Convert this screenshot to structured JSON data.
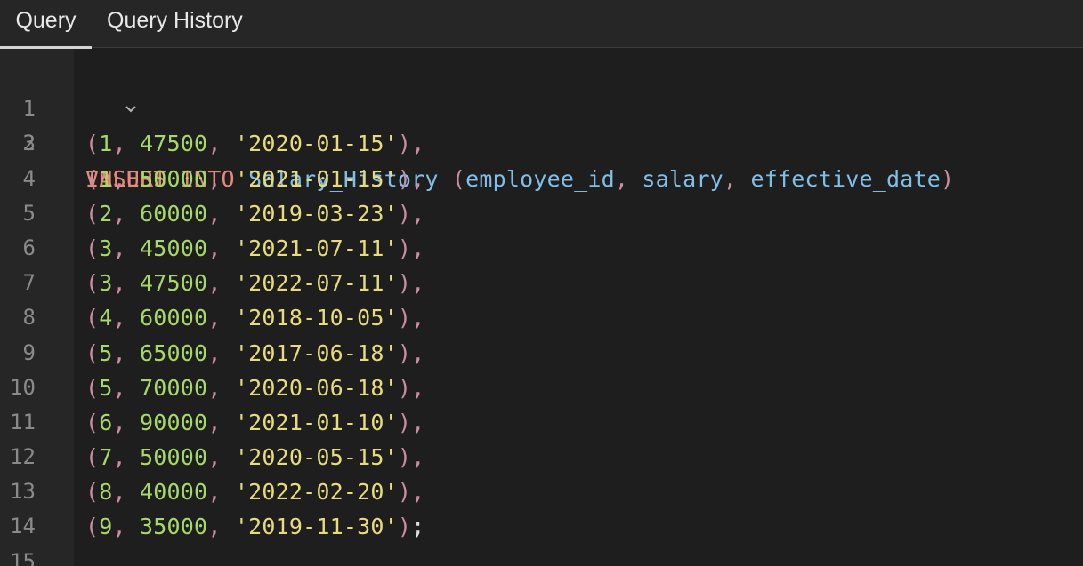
{
  "tabs": [
    {
      "label": "Query",
      "active": true
    },
    {
      "label": "Query History",
      "active": false
    }
  ],
  "editor": {
    "line_numbers": [
      "1",
      "2",
      "3",
      "4",
      "5",
      "6",
      "7",
      "8",
      "9",
      "10",
      "11",
      "12",
      "13",
      "14",
      "15"
    ],
    "fold_icon": "chevron-down-icon",
    "statement": {
      "insert_kw": "INSERT",
      "into_kw": "INTO",
      "table": "Salary_History",
      "columns": [
        "employee_id",
        "salary",
        "effective_date"
      ],
      "values_kw": "VALUES",
      "rows": [
        {
          "id": "1",
          "salary": "47500",
          "date": "'2020-01-15'",
          "end": ","
        },
        {
          "id": "1",
          "salary": "50000",
          "date": "'2021-01-15'",
          "end": ","
        },
        {
          "id": "2",
          "salary": "60000",
          "date": "'2019-03-23'",
          "end": ","
        },
        {
          "id": "3",
          "salary": "45000",
          "date": "'2021-07-11'",
          "end": ","
        },
        {
          "id": "3",
          "salary": "47500",
          "date": "'2022-07-11'",
          "end": ","
        },
        {
          "id": "4",
          "salary": "60000",
          "date": "'2018-10-05'",
          "end": ","
        },
        {
          "id": "5",
          "salary": "65000",
          "date": "'2017-06-18'",
          "end": ","
        },
        {
          "id": "5",
          "salary": "70000",
          "date": "'2020-06-18'",
          "end": ","
        },
        {
          "id": "6",
          "salary": "90000",
          "date": "'2021-01-10'",
          "end": ","
        },
        {
          "id": "7",
          "salary": "50000",
          "date": "'2020-05-15'",
          "end": ","
        },
        {
          "id": "8",
          "salary": "40000",
          "date": "'2022-02-20'",
          "end": ","
        },
        {
          "id": "9",
          "salary": "35000",
          "date": "'2019-11-30'",
          "end": ";"
        }
      ]
    }
  },
  "colors": {
    "keyword": "#e58a7a",
    "identifier": "#7fbfe8",
    "number": "#a6d96a",
    "string": "#e6dc7d",
    "punctuation": "#c98ea3"
  }
}
